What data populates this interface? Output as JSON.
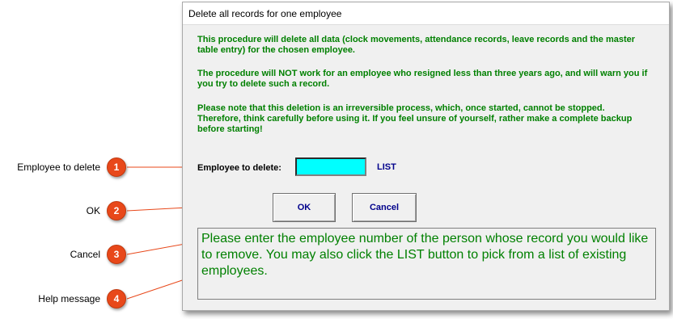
{
  "dialog": {
    "title": "Delete all records for one employee",
    "paragraphs": [
      "This procedure will delete all data (clock movements, attendance records, leave records and the master table entry) for the chosen employee.",
      "The procedure will NOT work for an employee who resigned less than three years ago, and will warn you if you try to delete such a record.",
      "Please note that this deletion is an irreversible process, which, once started, cannot be stopped. Therefore, think carefully before using it. If you feel unsure of yourself, rather make a complete backup before starting!"
    ],
    "employee_label": "Employee to delete:",
    "employee_value": "",
    "list_label": "LIST",
    "ok_label": "OK",
    "cancel_label": "Cancel",
    "help_message": "Please enter the employee number of the person whose record you would like to remove. You may also click the LIST button to pick from a list of existing employees."
  },
  "callouts": [
    {
      "number": "1",
      "label": "Employee to delete"
    },
    {
      "number": "2",
      "label": "OK"
    },
    {
      "number": "3",
      "label": "Cancel"
    },
    {
      "number": "4",
      "label": "Help message"
    }
  ],
  "colors": {
    "accent_green": "#008000",
    "button_text": "#00008b",
    "input_bg": "#00ffff",
    "badge": "#e8481a"
  }
}
